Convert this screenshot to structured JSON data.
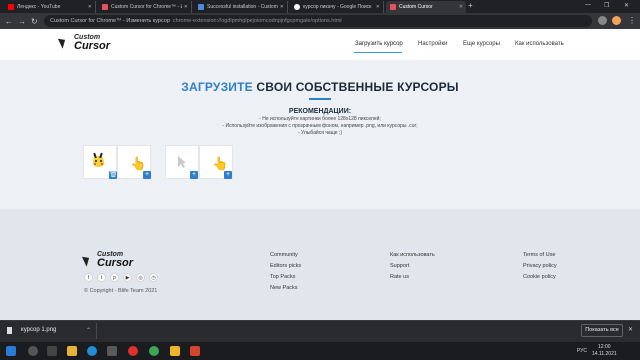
{
  "browser": {
    "tabs": [
      {
        "title": "Лендекс - YouTube",
        "color": "#ff0000"
      },
      {
        "title": "Custom Cursor for Chrome™ - И",
        "color": "#e8505b"
      },
      {
        "title": "Successful installation - Custom",
        "color": "#4a8bdb"
      },
      {
        "title": "курсор пикачу - Google Поиск",
        "color": "#ffffff"
      },
      {
        "title": "Custom Cursor",
        "color": "#e8505b"
      }
    ],
    "new_tab": "+",
    "omnibox_site": "Custom Cursor for Chrome™ - Изменить курсор",
    "omnibox_url": "chrome-extension://ogdlpmhglpejoiomcodnpjnfgcpmgale/options.html"
  },
  "site": {
    "logo_top": "Custom",
    "logo_bottom": "Cursor",
    "nav": [
      "Загрузить курсор",
      "Настройки",
      "Еще курсоры",
      "Как использовать"
    ],
    "hero_accent": "ЗАГРУЗИТЕ",
    "hero_rest": " СВОИ СОБСТВЕННЫЕ КУРСОРЫ",
    "rec_title": "РЕКОМЕНДАЦИИ:",
    "rec_lines": [
      "- Не используйте картинки более 128х128 пикселей;",
      "- Используйте изображения с прозрачным фоном, например .png, или курсоры .cur;",
      "- Улыбайся чаще ;)"
    ],
    "slot_icon_delete": "🗑",
    "slot_icon_add": "+",
    "cursor_glyph": "👆"
  },
  "footer": {
    "logo_top": "Custom",
    "logo_bottom": "Cursor",
    "social": [
      "f",
      "t",
      "p",
      "▶",
      "◎",
      "◷"
    ],
    "copyright": "© Copyright - Blife Team 2021",
    "col1": [
      "Community",
      "Editors picks",
      "Top Packs",
      "New Packs"
    ],
    "col2": [
      "Как использовать",
      "Support",
      "Rate us"
    ],
    "col3": [
      "Terms of Use",
      "Privacy policy",
      "Cookie policy"
    ]
  },
  "downloads": {
    "file": "курсор 1.png",
    "show_all": "Показать все",
    "close": "✕"
  },
  "taskbar": {
    "lang": "РУС",
    "time": "12:00",
    "date": "14.11.2021"
  }
}
